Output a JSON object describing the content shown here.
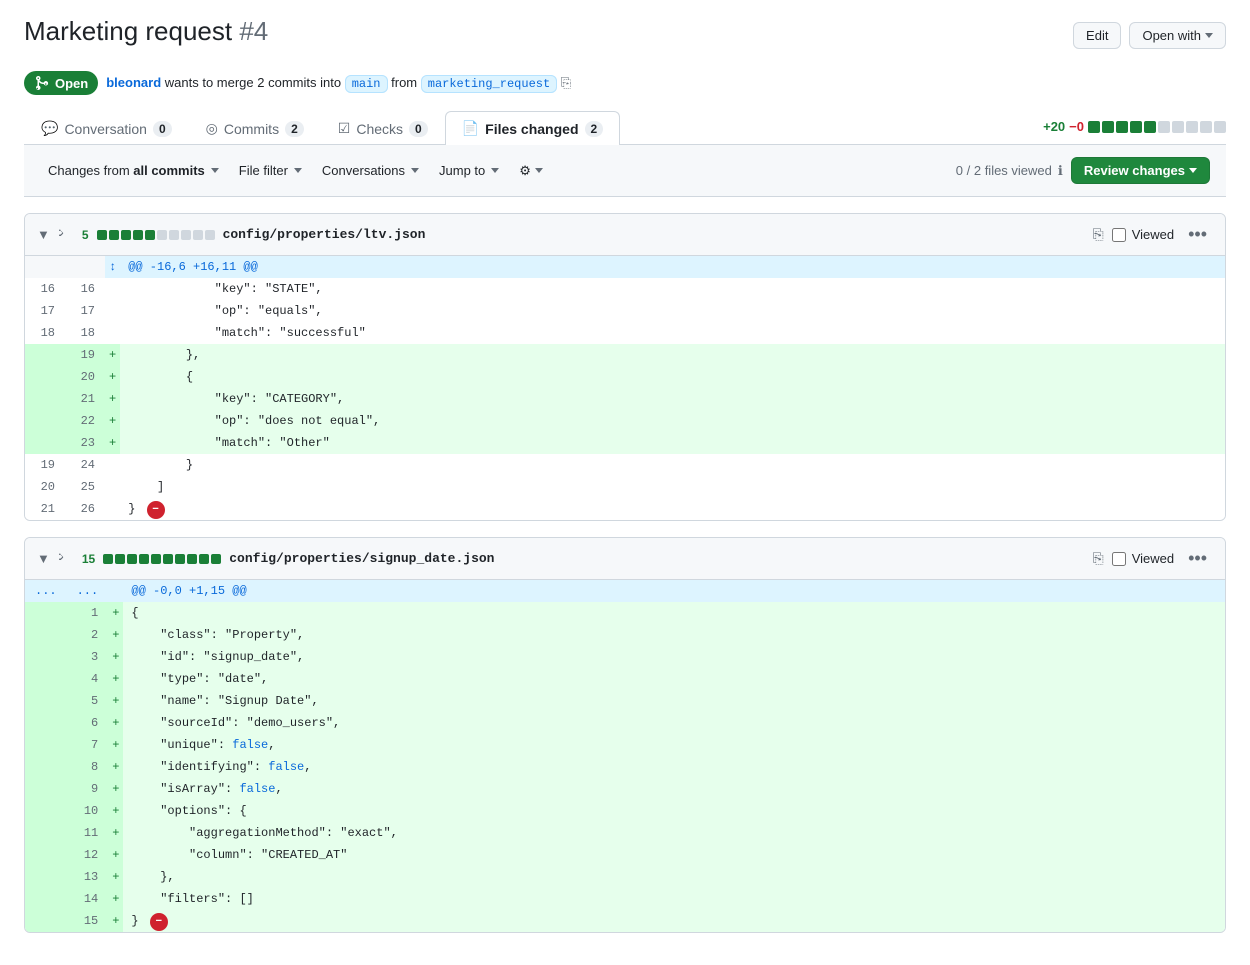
{
  "page": {
    "title": "Marketing request",
    "pr_number": "#4",
    "status": "Open",
    "author": "bleonard",
    "merge_desc": "wants to merge 2 commits into",
    "base_branch": "main",
    "from_text": "from",
    "head_branch": "marketing_request"
  },
  "buttons": {
    "edit": "Edit",
    "open_with": "Open with",
    "review_changes": "Review changes"
  },
  "tabs": [
    {
      "id": "conversation",
      "label": "Conversation",
      "count": "0",
      "active": false
    },
    {
      "id": "commits",
      "label": "Commits",
      "count": "2",
      "active": false
    },
    {
      "id": "checks",
      "label": "Checks",
      "count": "0",
      "active": false
    },
    {
      "id": "files_changed",
      "label": "Files changed",
      "count": "2",
      "active": true
    }
  ],
  "diff_stats": {
    "additions": "+20",
    "deletions": "−0"
  },
  "toolbar": {
    "changes_from": "Changes from",
    "all_commits": "all commits",
    "file_filter": "File filter",
    "conversations": "Conversations",
    "jump_to": "Jump to",
    "files_viewed": "0 / 2 files viewed"
  },
  "files": [
    {
      "id": "file1",
      "collapsed": false,
      "additions": 5,
      "squares": [
        1,
        1,
        1,
        1,
        1,
        0,
        0,
        0,
        0,
        0
      ],
      "path": "config/properties/ltv.json",
      "viewed": false,
      "hunk_header": "@@ -16,6 +16,11 @@",
      "lines": [
        {
          "type": "context",
          "old": "16",
          "new": "16",
          "prefix": " ",
          "content": "            \"key\": \"STATE\","
        },
        {
          "type": "context",
          "old": "17",
          "new": "17",
          "prefix": " ",
          "content": "            \"op\": \"equals\","
        },
        {
          "type": "context",
          "old": "18",
          "new": "18",
          "prefix": " ",
          "content": "            \"match\": \"successful\""
        },
        {
          "type": "added",
          "old": "",
          "new": "19",
          "prefix": "+",
          "content": "        },"
        },
        {
          "type": "added",
          "old": "",
          "new": "20",
          "prefix": "+",
          "content": "        {"
        },
        {
          "type": "added",
          "old": "",
          "new": "21",
          "prefix": "+",
          "content": "            \"key\": \"CATEGORY\","
        },
        {
          "type": "added",
          "old": "",
          "new": "22",
          "prefix": "+",
          "content": "            \"op\": \"does not equal\","
        },
        {
          "type": "added",
          "old": "",
          "new": "23",
          "prefix": "+",
          "content": "            \"match\": \"Other\""
        },
        {
          "type": "context",
          "old": "19",
          "new": "24",
          "prefix": " ",
          "content": "        }"
        },
        {
          "type": "context",
          "old": "20",
          "new": "25",
          "prefix": " ",
          "content": "    ]"
        },
        {
          "type": "context",
          "old": "21",
          "new": "26",
          "prefix": " ",
          "content": "}"
        }
      ]
    },
    {
      "id": "file2",
      "collapsed": false,
      "additions": 15,
      "squares": [
        1,
        1,
        1,
        1,
        1,
        1,
        1,
        1,
        1,
        1
      ],
      "path": "config/properties/signup_date.json",
      "viewed": false,
      "hunk_header": "@@ -0,0 +1,15 @@",
      "hunk_prefix": "...",
      "lines": [
        {
          "type": "added",
          "old": "",
          "new": "1",
          "prefix": "+",
          "content": "{"
        },
        {
          "type": "added",
          "old": "",
          "new": "2",
          "prefix": "+",
          "content": "    \"class\": \"Property\","
        },
        {
          "type": "added",
          "old": "",
          "new": "3",
          "prefix": "+",
          "content": "    \"id\": \"signup_date\","
        },
        {
          "type": "added",
          "old": "",
          "new": "4",
          "prefix": "+",
          "content": "    \"type\": \"date\","
        },
        {
          "type": "added",
          "old": "",
          "new": "5",
          "prefix": "+",
          "content": "    \"name\": \"Signup Date\","
        },
        {
          "type": "added",
          "old": "",
          "new": "6",
          "prefix": "+",
          "content": "    \"sourceId\": \"demo_users\","
        },
        {
          "type": "added",
          "old": "",
          "new": "7",
          "prefix": "+",
          "content": "    \"unique\": false,"
        },
        {
          "type": "added",
          "old": "",
          "new": "8",
          "prefix": "+",
          "content": "    \"identifying\": false,"
        },
        {
          "type": "added",
          "old": "",
          "new": "9",
          "prefix": "+",
          "content": "    \"isArray\": false,"
        },
        {
          "type": "added",
          "old": "",
          "new": "10",
          "prefix": "+",
          "content": "    \"options\": {"
        },
        {
          "type": "added",
          "old": "",
          "new": "11",
          "prefix": "+",
          "content": "        \"aggregationMethod\": \"exact\","
        },
        {
          "type": "added",
          "old": "",
          "new": "12",
          "prefix": "+",
          "content": "        \"column\": \"CREATED_AT\""
        },
        {
          "type": "added",
          "old": "",
          "new": "13",
          "prefix": "+",
          "content": "    },"
        },
        {
          "type": "added",
          "old": "",
          "new": "14",
          "prefix": "+",
          "content": "    \"filters\": []"
        },
        {
          "type": "added",
          "old": "",
          "new": "15",
          "prefix": "+",
          "content": "}"
        }
      ]
    }
  ]
}
